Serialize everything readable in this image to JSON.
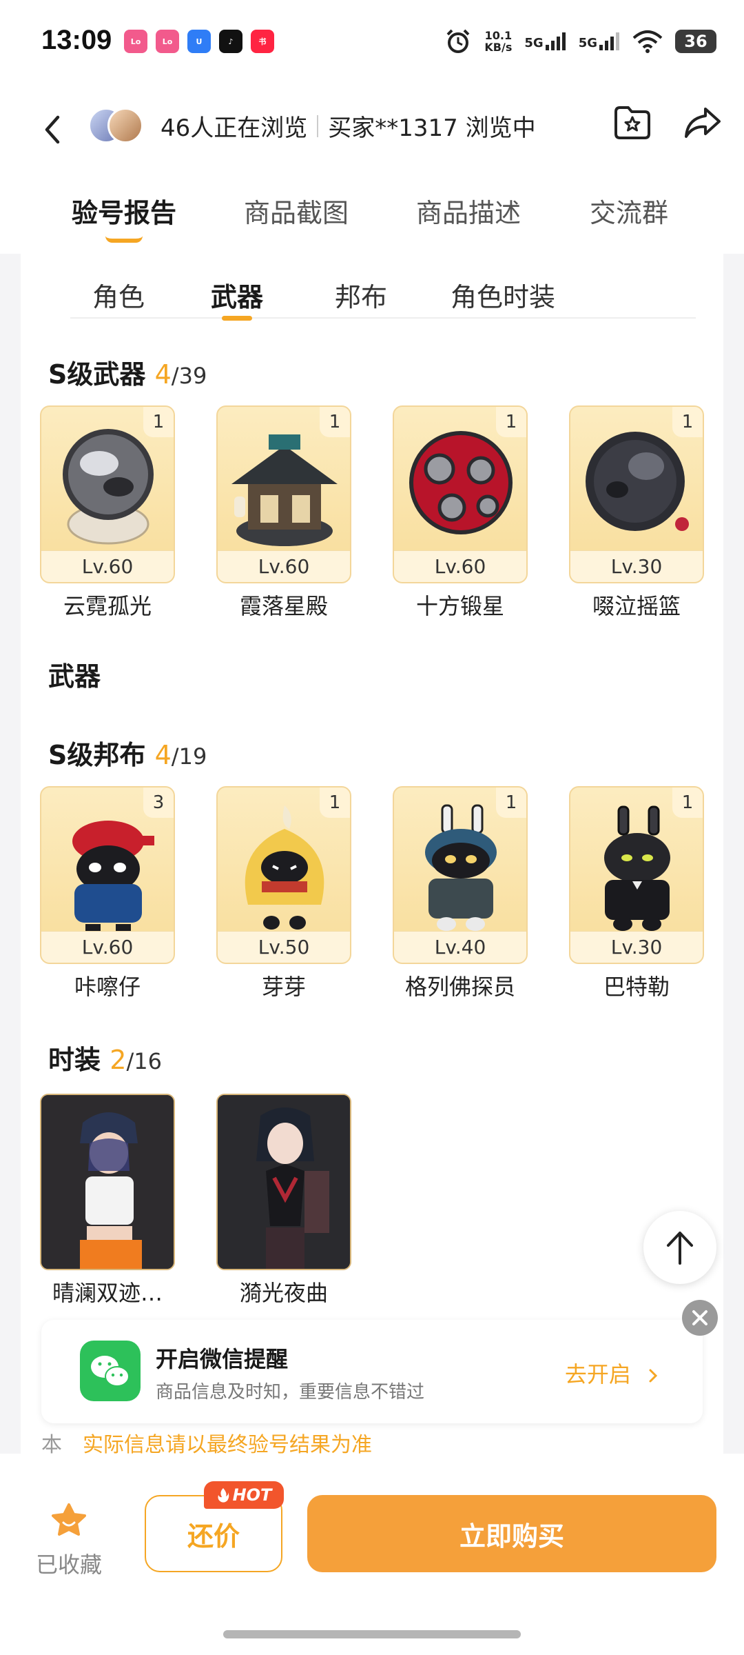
{
  "status_bar": {
    "time": "13:09",
    "apps": [
      {
        "name": "lofter-icon",
        "label": "Lo",
        "color": "#f25a8c"
      },
      {
        "name": "lofter-icon-2",
        "label": "Lo",
        "color": "#f25a8c"
      },
      {
        "name": "app-u-icon",
        "label": "U",
        "color": "#2f7df6"
      },
      {
        "name": "tiktok-icon",
        "label": "♪",
        "color": "#111111"
      },
      {
        "name": "xiaohongshu-icon",
        "label": "书",
        "color": "#ff2442"
      }
    ],
    "net_speed_value": "10.1",
    "net_speed_unit": "KB/s",
    "signal1": "5G",
    "signal2": "5G",
    "battery": "36"
  },
  "header": {
    "viewers_text": "46人正在浏览",
    "buyer_text": "买家**1317 浏览中"
  },
  "tabs": [
    {
      "label": "验号报告",
      "active": true
    },
    {
      "label": "商品截图",
      "active": false
    },
    {
      "label": "商品描述",
      "active": false
    },
    {
      "label": "交流群",
      "active": false
    }
  ],
  "subtabs": [
    {
      "label": "角色",
      "active": false
    },
    {
      "label": "武器",
      "active": true
    },
    {
      "label": "邦布",
      "active": false
    },
    {
      "label": "角色时装",
      "active": false
    }
  ],
  "s_weapons": {
    "title": "S级武器",
    "count": "4",
    "total": "/39",
    "items": [
      {
        "name": "云霓孤光",
        "level": "Lv.60",
        "qty": "1"
      },
      {
        "name": "霞落星殿",
        "level": "Lv.60",
        "qty": "1"
      },
      {
        "name": "十方锻星",
        "level": "Lv.60",
        "qty": "1"
      },
      {
        "name": "啜泣摇篮",
        "level": "Lv.30",
        "qty": "1"
      }
    ]
  },
  "weapons_heading": "武器",
  "s_bangboo": {
    "title": "S级邦布",
    "count": "4",
    "total": "/19",
    "items": [
      {
        "name": "咔嚓仔",
        "level": "Lv.60",
        "qty": "3"
      },
      {
        "name": "芽芽",
        "level": "Lv.50",
        "qty": "1"
      },
      {
        "name": "格列佛探员",
        "level": "Lv.40",
        "qty": "1"
      },
      {
        "name": "巴特勒",
        "level": "Lv.30",
        "qty": "1"
      }
    ]
  },
  "skins": {
    "title": "时装",
    "count": "2",
    "total": "/16",
    "items": [
      {
        "name": "晴澜双迹…"
      },
      {
        "name": "漪光夜曲"
      }
    ]
  },
  "partial_text": {
    "prefix": "本",
    "orange": "实际信息请以最终验号结果为准"
  },
  "wechat_banner": {
    "title": "开启微信提醒",
    "subtitle": "商品信息及时知，重要信息不错过",
    "action": "去开启"
  },
  "bottom_bar": {
    "fav_label": "已收藏",
    "bargain_label": "还价",
    "hot_label": "HOT",
    "buy_label": "立即购买"
  }
}
